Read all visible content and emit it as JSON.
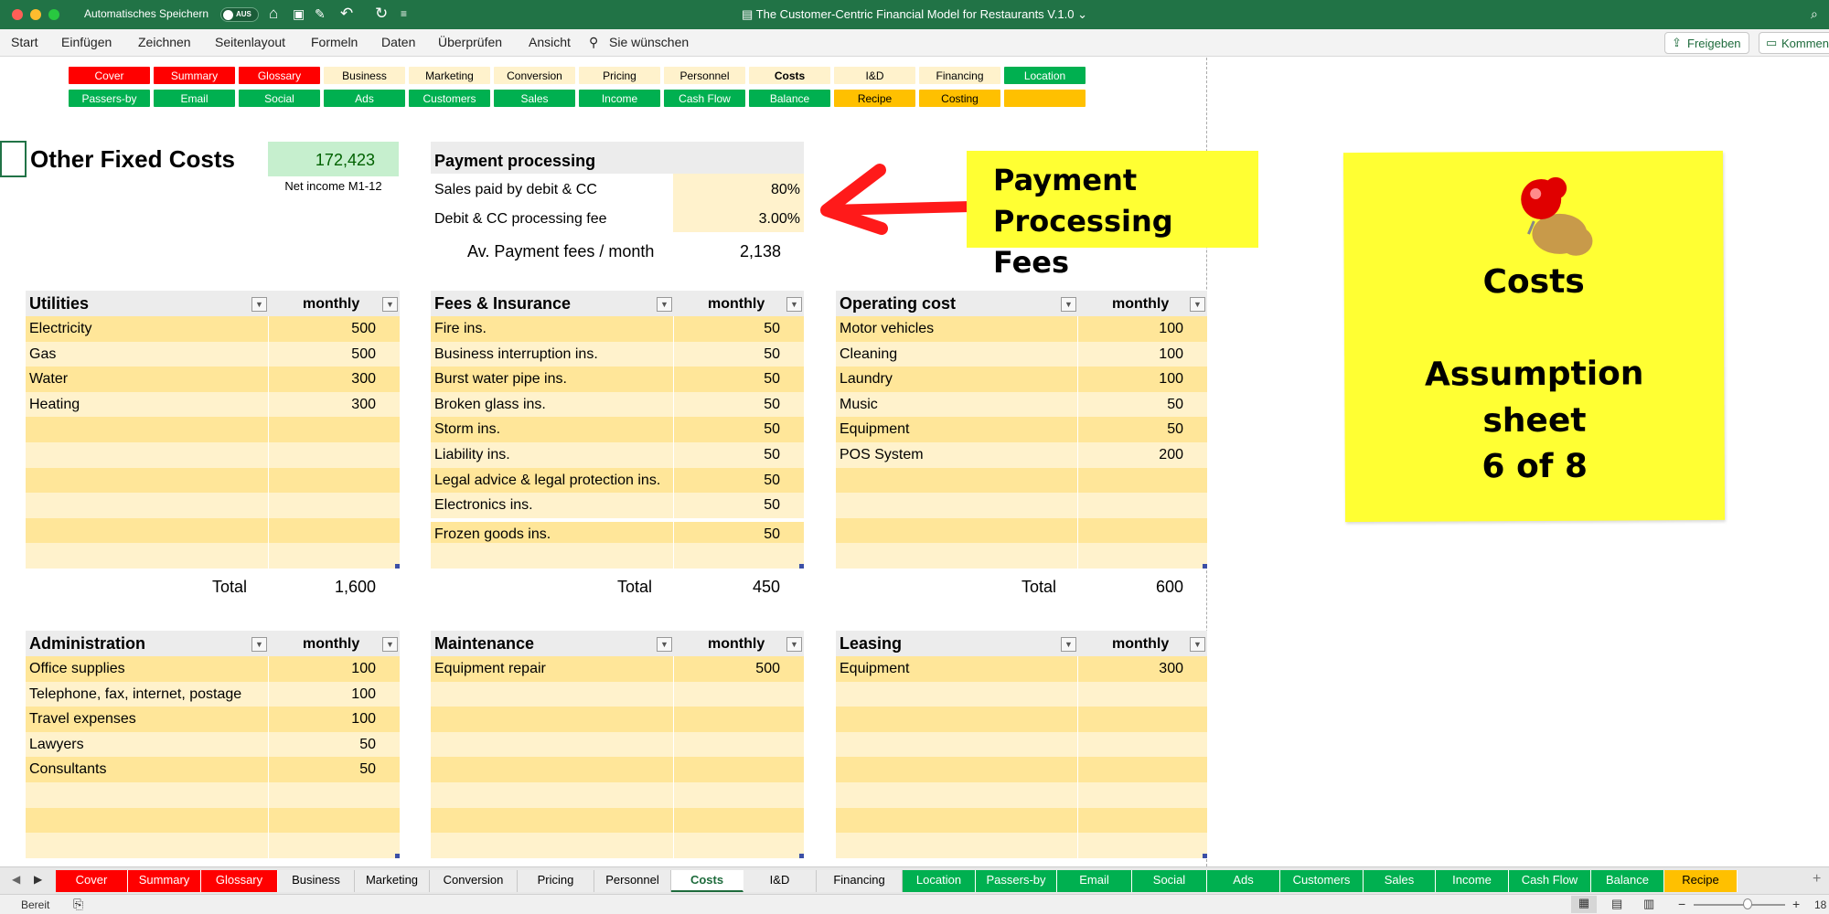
{
  "titlebar": {
    "autosave_label": "Automatisches Speichern",
    "autosave_state": "AUS",
    "doc_title": "The Customer-Centric Financial Model for Restaurants V.1.0"
  },
  "menu": [
    "Start",
    "Einfügen",
    "Zeichnen",
    "Seitenlayout",
    "Formeln",
    "Daten",
    "Überprüfen",
    "Ansicht"
  ],
  "tell_me": "Sie wünschen",
  "share_label": "Freigeben",
  "comment_label": "Kommen",
  "nav_row1": [
    {
      "label": "Cover",
      "color": "red"
    },
    {
      "label": "Summary",
      "color": "red"
    },
    {
      "label": "Glossary",
      "color": "red"
    },
    {
      "label": "Business",
      "color": "cream"
    },
    {
      "label": "Marketing",
      "color": "cream"
    },
    {
      "label": "Conversion",
      "color": "cream"
    },
    {
      "label": "Pricing",
      "color": "cream"
    },
    {
      "label": "Personnel",
      "color": "cream"
    },
    {
      "label": "Costs",
      "color": "cream"
    },
    {
      "label": "I&D",
      "color": "cream"
    },
    {
      "label": "Financing",
      "color": "cream"
    },
    {
      "label": "Location",
      "color": "green"
    }
  ],
  "nav_row2": [
    {
      "label": "Passers-by",
      "color": "green"
    },
    {
      "label": "Email",
      "color": "green"
    },
    {
      "label": "Social",
      "color": "green"
    },
    {
      "label": "Ads",
      "color": "green"
    },
    {
      "label": "Customers",
      "color": "green"
    },
    {
      "label": "Sales",
      "color": "green"
    },
    {
      "label": "Income",
      "color": "green"
    },
    {
      "label": "Cash Flow",
      "color": "green"
    },
    {
      "label": "Balance",
      "color": "green"
    },
    {
      "label": "Recipe",
      "color": "orange"
    },
    {
      "label": "Costing",
      "color": "orange"
    },
    {
      "label": "",
      "color": "orange"
    }
  ],
  "page_title": "Other Fixed Costs",
  "net_income": {
    "value": "172,423",
    "label": "Net income M1-12"
  },
  "payment": {
    "title": "Payment processing",
    "rows": [
      {
        "label": "Sales paid by debit & CC",
        "value": "80%"
      },
      {
        "label": "Debit & CC processing fee",
        "value": "3.00%"
      }
    ],
    "avg_label": "Av. Payment fees / month",
    "avg_value": "2,138"
  },
  "callout": {
    "line1": "Payment",
    "line2": "Processing Fees"
  },
  "note": {
    "title": "Costs",
    "line1": "Assumption",
    "line2": "sheet",
    "line3": "6 of 8"
  },
  "tables": [
    {
      "name": "Utilities",
      "col": "monthly",
      "rows": [
        [
          "Electricity",
          "500"
        ],
        [
          "Gas",
          "500"
        ],
        [
          "Water",
          "300"
        ],
        [
          "Heating",
          "300"
        ],
        [
          "",
          ""
        ],
        [
          "",
          ""
        ],
        [
          "",
          ""
        ],
        [
          "",
          ""
        ],
        [
          "",
          ""
        ],
        [
          "",
          ""
        ]
      ],
      "total_label": "Total",
      "total": "1,600"
    },
    {
      "name": "Fees & Insurance",
      "col": "monthly",
      "rows": [
        [
          "Fire ins.",
          "50"
        ],
        [
          "Business interruption ins.",
          "50"
        ],
        [
          "Burst water pipe ins.",
          "50"
        ],
        [
          "Broken glass ins.",
          "50"
        ],
        [
          "Storm ins.",
          "50"
        ],
        [
          "Liability ins.",
          "50"
        ],
        [
          "Legal advice & legal protection ins.",
          "50"
        ],
        [
          "Electronics ins.",
          "50"
        ],
        [
          "Frozen goods ins.",
          "50"
        ],
        [
          "",
          ""
        ]
      ],
      "total_label": "Total",
      "total": "450"
    },
    {
      "name": "Operating cost",
      "col": "monthly",
      "rows": [
        [
          "Motor vehicles",
          "100"
        ],
        [
          "Cleaning",
          "100"
        ],
        [
          "Laundry",
          "100"
        ],
        [
          "Music",
          "50"
        ],
        [
          "Equipment",
          "50"
        ],
        [
          "POS System",
          "200"
        ],
        [
          "",
          ""
        ],
        [
          "",
          ""
        ],
        [
          "",
          ""
        ],
        [
          "",
          ""
        ]
      ],
      "total_label": "Total",
      "total": "600"
    },
    {
      "name": "Administration",
      "col": "monthly",
      "rows": [
        [
          "Office supplies",
          "100"
        ],
        [
          "Telephone, fax, internet, postage",
          "100"
        ],
        [
          "Travel expenses",
          "100"
        ],
        [
          "Lawyers",
          "50"
        ],
        [
          "Consultants",
          "50"
        ],
        [
          "",
          ""
        ],
        [
          "",
          ""
        ],
        [
          "",
          ""
        ]
      ]
    },
    {
      "name": "Maintenance",
      "col": "monthly",
      "rows": [
        [
          "Equipment repair",
          "500"
        ],
        [
          "",
          ""
        ],
        [
          "",
          ""
        ],
        [
          "",
          ""
        ],
        [
          "",
          ""
        ],
        [
          "",
          ""
        ],
        [
          "",
          ""
        ],
        [
          "",
          ""
        ]
      ]
    },
    {
      "name": "Leasing",
      "col": "monthly",
      "rows": [
        [
          "Equipment",
          "300"
        ],
        [
          "",
          ""
        ],
        [
          "",
          ""
        ],
        [
          "",
          ""
        ],
        [
          "",
          ""
        ],
        [
          "",
          ""
        ],
        [
          "",
          ""
        ],
        [
          "",
          ""
        ]
      ]
    }
  ],
  "sheet_tabs": [
    {
      "label": "Cover",
      "color": "red"
    },
    {
      "label": "Summary",
      "color": "red"
    },
    {
      "label": "Glossary",
      "color": "red"
    },
    {
      "label": "Business",
      "color": "plain"
    },
    {
      "label": "Marketing",
      "color": "plain"
    },
    {
      "label": "Conversion",
      "color": "plain"
    },
    {
      "label": "Pricing",
      "color": "plain"
    },
    {
      "label": "Personnel",
      "color": "plain"
    },
    {
      "label": "Costs",
      "color": "active"
    },
    {
      "label": "I&D",
      "color": "plain"
    },
    {
      "label": "Financing",
      "color": "plain"
    },
    {
      "label": "Location",
      "color": "green"
    },
    {
      "label": "Passers-by",
      "color": "green"
    },
    {
      "label": "Email",
      "color": "green"
    },
    {
      "label": "Social",
      "color": "green"
    },
    {
      "label": "Ads",
      "color": "green"
    },
    {
      "label": "Customers",
      "color": "green"
    },
    {
      "label": "Sales",
      "color": "green"
    },
    {
      "label": "Income",
      "color": "green"
    },
    {
      "label": "Cash Flow",
      "color": "green"
    },
    {
      "label": "Balance",
      "color": "green"
    },
    {
      "label": "Recipe",
      "color": "orange"
    }
  ],
  "status": {
    "ready": "Bereit",
    "zoom": "18"
  },
  "colors": {
    "excel_green": "#217346",
    "light_row": "#fff2cc",
    "dark_row": "#ffe699",
    "note_yellow": "#ffff33",
    "red": "#ff0000",
    "green": "#00b050",
    "orange": "#ffc000"
  }
}
